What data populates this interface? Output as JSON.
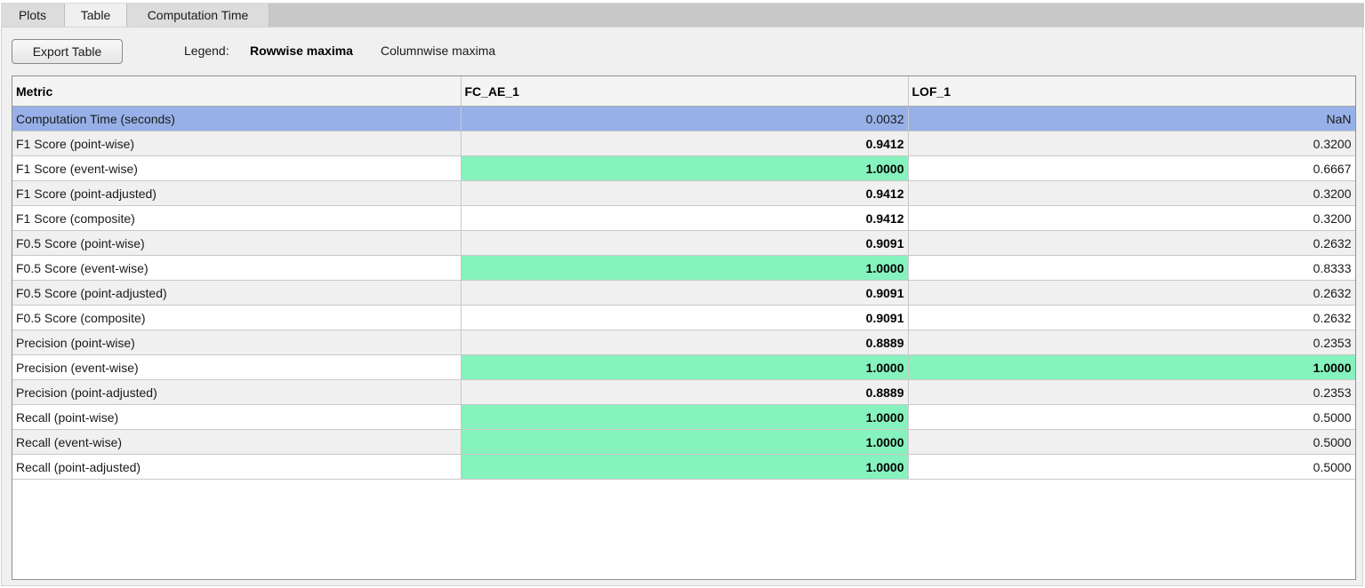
{
  "tabs": [
    {
      "label": "Plots"
    },
    {
      "label": "Table"
    },
    {
      "label": "Computation Time"
    }
  ],
  "active_tab": "Table",
  "toolbar": {
    "export_label": "Export Table",
    "legend_label": "Legend:",
    "legend_rowwise": "Rowwise maxima",
    "legend_columnwise": "Columnwise maxima"
  },
  "colors": {
    "columnwise_max": "#86f2bd",
    "selected_row": "#97b1e8",
    "stripe": "#f0f0f0"
  },
  "table": {
    "columns": [
      "Metric",
      "FC_AE_1",
      "LOF_1"
    ],
    "rows": [
      {
        "metric": "Computation Time (seconds)",
        "values": [
          "0.0032",
          "NaN"
        ],
        "rowmax": [
          false,
          false
        ],
        "colmax": [
          false,
          false
        ],
        "selected": true
      },
      {
        "metric": "F1 Score (point-wise)",
        "values": [
          "0.9412",
          "0.3200"
        ],
        "rowmax": [
          true,
          false
        ],
        "colmax": [
          false,
          false
        ]
      },
      {
        "metric": "F1 Score (event-wise)",
        "values": [
          "1.0000",
          "0.6667"
        ],
        "rowmax": [
          true,
          false
        ],
        "colmax": [
          true,
          false
        ]
      },
      {
        "metric": "F1 Score (point-adjusted)",
        "values": [
          "0.9412",
          "0.3200"
        ],
        "rowmax": [
          true,
          false
        ],
        "colmax": [
          false,
          false
        ]
      },
      {
        "metric": "F1 Score (composite)",
        "values": [
          "0.9412",
          "0.3200"
        ],
        "rowmax": [
          true,
          false
        ],
        "colmax": [
          false,
          false
        ]
      },
      {
        "metric": "F0.5 Score (point-wise)",
        "values": [
          "0.9091",
          "0.2632"
        ],
        "rowmax": [
          true,
          false
        ],
        "colmax": [
          false,
          false
        ]
      },
      {
        "metric": "F0.5 Score (event-wise)",
        "values": [
          "1.0000",
          "0.8333"
        ],
        "rowmax": [
          true,
          false
        ],
        "colmax": [
          true,
          false
        ]
      },
      {
        "metric": "F0.5 Score (point-adjusted)",
        "values": [
          "0.9091",
          "0.2632"
        ],
        "rowmax": [
          true,
          false
        ],
        "colmax": [
          false,
          false
        ]
      },
      {
        "metric": "F0.5 Score (composite)",
        "values": [
          "0.9091",
          "0.2632"
        ],
        "rowmax": [
          true,
          false
        ],
        "colmax": [
          false,
          false
        ]
      },
      {
        "metric": "Precision (point-wise)",
        "values": [
          "0.8889",
          "0.2353"
        ],
        "rowmax": [
          true,
          false
        ],
        "colmax": [
          false,
          false
        ]
      },
      {
        "metric": "Precision (event-wise)",
        "values": [
          "1.0000",
          "1.0000"
        ],
        "rowmax": [
          true,
          true
        ],
        "colmax": [
          true,
          true
        ]
      },
      {
        "metric": "Precision (point-adjusted)",
        "values": [
          "0.8889",
          "0.2353"
        ],
        "rowmax": [
          true,
          false
        ],
        "colmax": [
          false,
          false
        ]
      },
      {
        "metric": "Recall (point-wise)",
        "values": [
          "1.0000",
          "0.5000"
        ],
        "rowmax": [
          true,
          false
        ],
        "colmax": [
          true,
          false
        ]
      },
      {
        "metric": "Recall (event-wise)",
        "values": [
          "1.0000",
          "0.5000"
        ],
        "rowmax": [
          true,
          false
        ],
        "colmax": [
          true,
          false
        ]
      },
      {
        "metric": "Recall (point-adjusted)",
        "values": [
          "1.0000",
          "0.5000"
        ],
        "rowmax": [
          true,
          false
        ],
        "colmax": [
          true,
          false
        ]
      }
    ]
  }
}
